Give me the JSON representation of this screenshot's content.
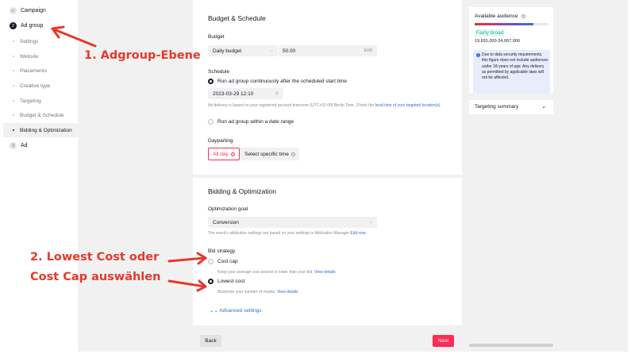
{
  "sidebar": {
    "steps": [
      {
        "num": "✓",
        "label": "Campaign"
      },
      {
        "num": "2",
        "label": "Ad group"
      },
      {
        "num": "3",
        "label": "Ad"
      }
    ],
    "subitems": [
      "Settings",
      "Website",
      "Placements",
      "Creative type",
      "Targeting",
      "Budget & Schedule",
      "Bidding & Optimization"
    ]
  },
  "budget": {
    "title": "Budget & Schedule",
    "budget_label": "Budget",
    "budget_type": "Daily budget",
    "budget_value": "50.00",
    "currency": "EUR",
    "schedule_label": "Schedule",
    "schedule_opt1": "Run ad group continuously after the scheduled start time",
    "start_datetime": "2023-03-29 12:10",
    "timezone_hint": "Ad delivery is based on your registered account timezone (UTC+01:00) Berlin Time. Check the",
    "timezone_link": "local time of your targeted location(s)",
    "schedule_opt2": "Run ad group within a date range",
    "dayparting_label": "Dayparting",
    "dayparting_allday": "All day",
    "dayparting_specific": "Select specific time"
  },
  "bidding": {
    "title": "Bidding & Optimization",
    "goal_label": "Optimization goal",
    "goal_value": "Conversion",
    "goal_hint": "The event's attribution settings are based on your settings in Attribution Manager",
    "goal_link": "Edit now",
    "strategy_label": "Bid strategy",
    "costcap_label": "Cost cap",
    "costcap_hint": "Keep your average cost around or lower than your bid.",
    "costcap_link": "View details",
    "lowest_label": "Lowest cost",
    "lowest_hint": "Maximize your number of results.",
    "lowest_link": "View details",
    "advanced": "Advanced settings"
  },
  "footer": {
    "back": "Back",
    "next": "Next"
  },
  "audience": {
    "title": "Available audience",
    "level": "Fairly broad",
    "range": "19,691,000-24,067,000",
    "notice": "Due to data security requirements, this figure does not include audiences under 18 years of age. Any delivery as permitted by applicable laws will not be affected.",
    "targeting_summary": "Targeting summary"
  },
  "annotations": {
    "first": "1. Adgroup-Ebene",
    "second_line1": "2. Lowest Cost oder",
    "second_line2": "Cost Cap auswählen"
  },
  "colors": {
    "accent": "#fe2c55",
    "annotation": "#e5392b",
    "link": "#2f6bd9",
    "notice_bg": "#e8ecfb"
  }
}
